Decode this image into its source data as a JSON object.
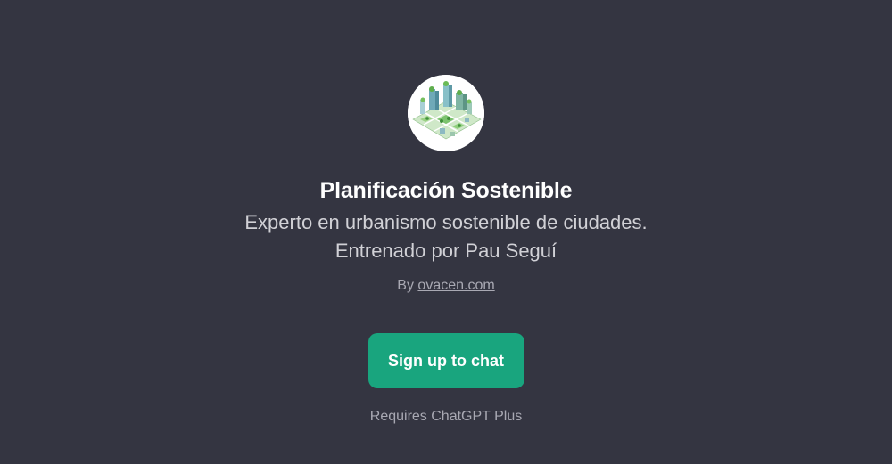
{
  "gpt": {
    "avatar_icon": "isometric-green-city-icon",
    "title": "Planificación Sostenible",
    "description_line1": "Experto en urbanismo sostenible de ciudades.",
    "description_line2": "Entrenado por Pau Seguí",
    "by_prefix": "By",
    "author": "ovacen.com"
  },
  "actions": {
    "signup_label": "Sign up to chat",
    "requirement": "Requires ChatGPT Plus"
  },
  "colors": {
    "background": "#343541",
    "button": "#19a57e",
    "text_primary": "#ffffff",
    "text_secondary": "#a9a9b3"
  }
}
